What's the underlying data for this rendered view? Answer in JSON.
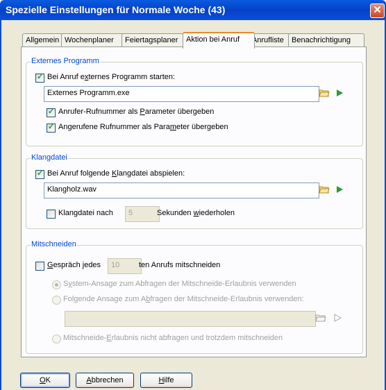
{
  "window": {
    "title": "Spezielle Einstellungen für Normale Woche (43)",
    "close": "✕"
  },
  "tabs": [
    {
      "label": "Allgemein"
    },
    {
      "label": "Wochenplaner"
    },
    {
      "label": "Feiertagsplaner"
    },
    {
      "label": "Aktion bei Anruf"
    },
    {
      "label": "Anrufliste"
    },
    {
      "label": "Benachrichtigung"
    }
  ],
  "ext": {
    "title": "Externes Programm",
    "start": {
      "pre": "Bei Anruf e",
      "u": "x",
      "post": "ternes Programm starten:",
      "checked": true
    },
    "program": "Externes Programm.exe",
    "caller": {
      "pre": "Anrufer-Rufnummer als ",
      "u": "P",
      "post": "arameter übergeben",
      "checked": true
    },
    "callee": {
      "pre": "Angerufene Rufnummer als Para",
      "u": "m",
      "post": "eter übergeben",
      "checked": true
    }
  },
  "sound": {
    "title": "Klangdatei",
    "play": {
      "pre": "Bei Anruf folgende ",
      "u": "K",
      "post": "langdatei abspielen:",
      "checked": true
    },
    "file": "Klangholz.wav",
    "repeat": {
      "pre": "Klangdatei nach",
      "checked": false
    },
    "seconds": "5",
    "repeat_post": {
      "pre": "Sekunden ",
      "u": "w",
      "post": "iederholen"
    }
  },
  "rec": {
    "title": "Mitschneiden",
    "record": {
      "pre": "",
      "u": "G",
      "post": "espräch jedes",
      "checked": false
    },
    "every": "10",
    "record_post": "ten Anrufs mitschneiden",
    "opt1": {
      "pre": "S",
      "u": "y",
      "post": "stem-Ansage zum Abfragen der Mitschneide-Erlaubnis verwenden",
      "selected": true
    },
    "opt2": {
      "pre": "Folgende Ansage zum A",
      "u": "b",
      "post": "fragen der Mitschneide-Erlaubnis verwenden:",
      "selected": false
    },
    "announcement": "",
    "opt3": {
      "pre": "Mitschneide-",
      "u": "E",
      "post": "rlaubnis nicht abfragen und trotzdem mitschneiden",
      "selected": false
    }
  },
  "buttons": {
    "ok": {
      "u": "O",
      "post": "K"
    },
    "cancel": {
      "u": "A",
      "post": "bbrechen"
    },
    "help": {
      "u": "H",
      "post": "ilfe"
    }
  },
  "icons": {
    "folder": "folder-icon",
    "play": "play-icon"
  },
  "colors": {
    "titlebar": "#0442c8",
    "group_title": "#0046d5",
    "play": "#2f9a2f",
    "check": "#21a121",
    "tab_active": "#e68b2c"
  }
}
